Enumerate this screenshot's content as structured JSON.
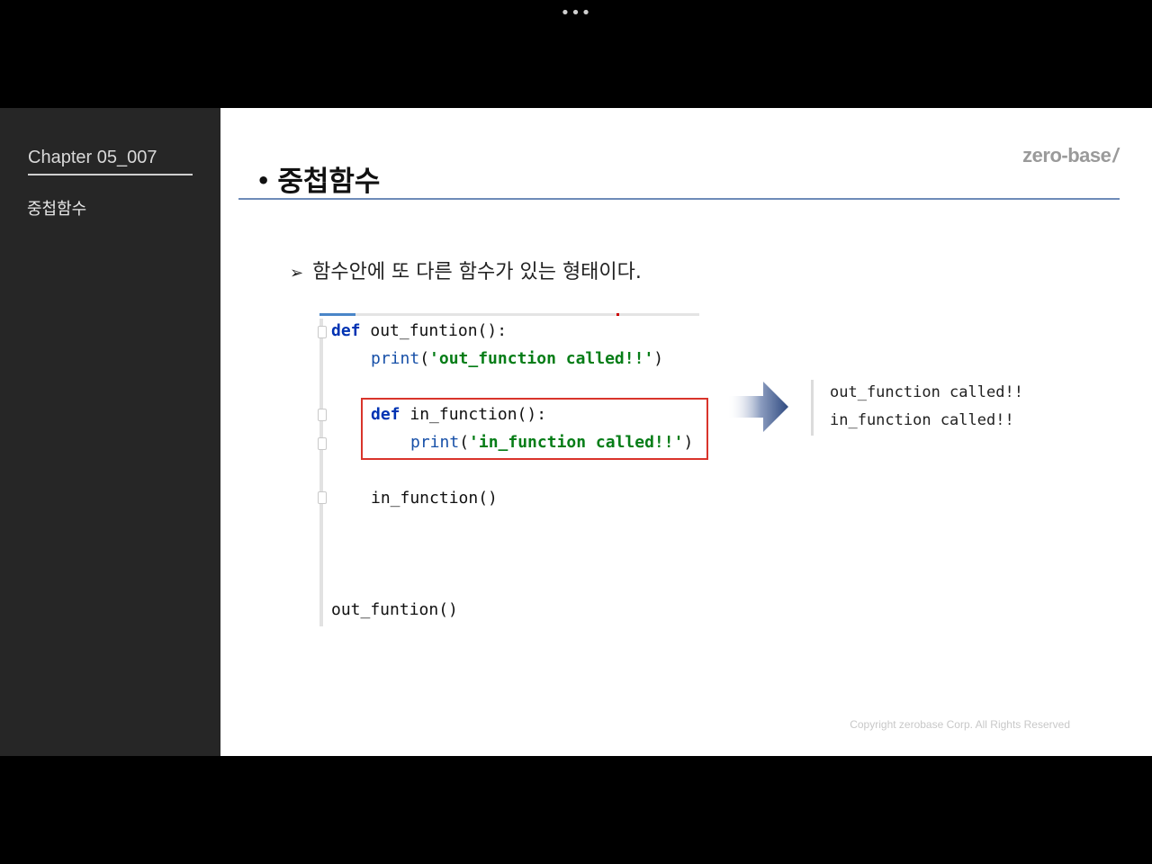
{
  "top_bar": {
    "menu_glyph": "•••"
  },
  "sidebar": {
    "chapter": "Chapter  05_007",
    "topic": "중첩함수"
  },
  "slide": {
    "brand": "zero-base",
    "brand_slash": "/",
    "title_bullet": "•",
    "title": "중첩함수",
    "desc_arrow": "➢",
    "description": "함수안에 또 다른 함수가 있는 형태이다.",
    "copyright": "Copyright zerobase Corp. All Rights Reserved"
  },
  "code": {
    "line1_kw": "def",
    "line1_rest": " out_funtion():",
    "line2_fn": "print",
    "line2_open": "(",
    "line2_str": "'out_function called!!'",
    "line2_close": ")",
    "line3_kw": "def",
    "line3_rest": " in_function():",
    "line4_fn": "print",
    "line4_open": "(",
    "line4_str": "'in_function called!!'",
    "line4_close": ")",
    "line5": "in_function()",
    "line6": "out_funtion()"
  },
  "output": {
    "lines": [
      "out_function called!!",
      "in_function called!!"
    ]
  },
  "colors": {
    "sidebar_bg": "#262626",
    "title_rule": "#6e8bb8",
    "highlight_box": "#d9342b",
    "keyword": "#0033b3",
    "string": "#067d17"
  },
  "icons": {
    "arrow": "right-arrow-icon",
    "menu": "more-dots-icon"
  }
}
